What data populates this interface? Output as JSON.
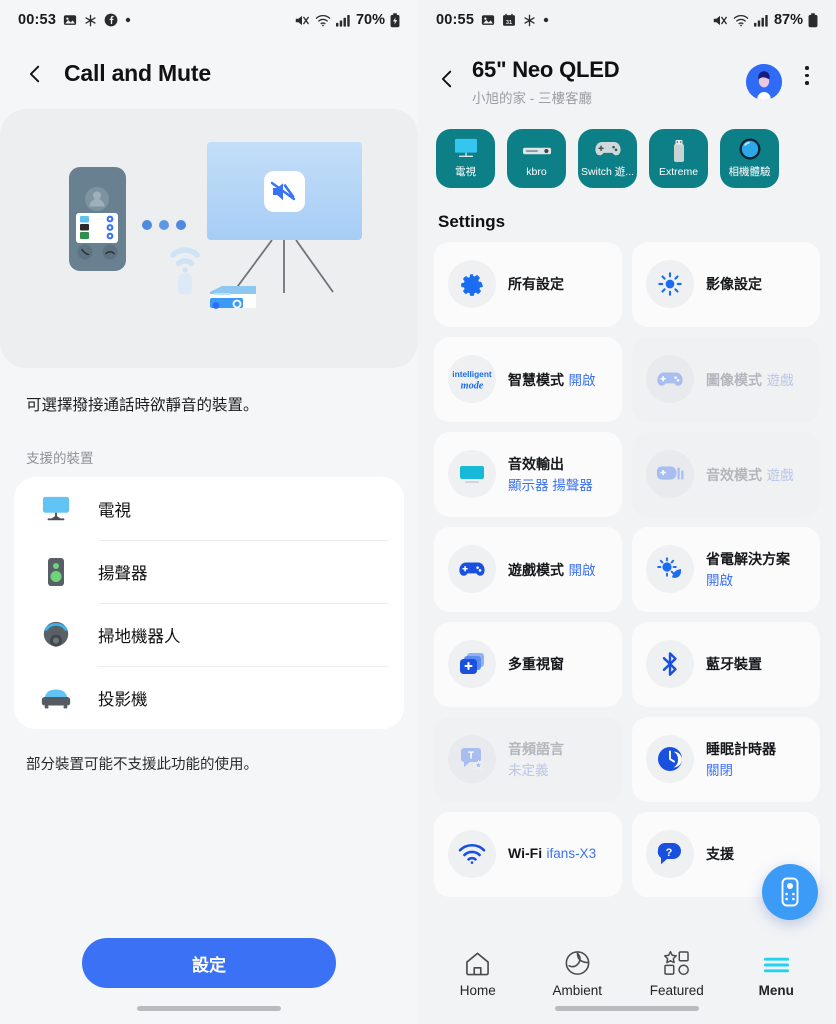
{
  "left": {
    "status": {
      "time": "00:53",
      "battery": "70%",
      "icons": [
        "photo-icon",
        "snowflake-icon",
        "facebook-icon",
        "dot-icon"
      ],
      "right_icons": [
        "mute-icon",
        "wifi-icon",
        "signal-icon",
        "battery-icon"
      ]
    },
    "appbar": {
      "title": "Call and Mute",
      "back": "back-chevron-icon"
    },
    "illustration": {
      "name": "call-mute-illustration",
      "mute_badge": "mute-icon"
    },
    "description": "可選擇撥接通話時欲靜音的裝置。",
    "section_label": "支援的裝置",
    "devices": [
      {
        "label": "電視",
        "icon": "tv-icon"
      },
      {
        "label": "揚聲器",
        "icon": "speaker-icon"
      },
      {
        "label": "掃地機器人",
        "icon": "robot-vacuum-icon"
      },
      {
        "label": "投影機",
        "icon": "projector-icon"
      }
    ],
    "note": "部分裝置可能不支援此功能的使用。",
    "cta": "設定"
  },
  "right": {
    "status": {
      "time": "00:55",
      "battery": "87%",
      "icons": [
        "photo-icon",
        "calendar-icon",
        "snowflake-icon",
        "dot-icon"
      ],
      "right_icons": [
        "mute-icon",
        "wifi-icon",
        "signal-icon",
        "battery-icon"
      ]
    },
    "appbar": {
      "title": "65\" Neo QLED",
      "subtitle": "小旭的家 - 三樓客廳",
      "back": "back-chevron-icon",
      "avatar": "user-avatar",
      "more": "more-options-icon"
    },
    "sources": [
      {
        "label": "電視",
        "icon": "tv-icon"
      },
      {
        "label": "kbro",
        "icon": "set-top-box-icon"
      },
      {
        "label": "Switch 遊...",
        "icon": "gamepad-icon"
      },
      {
        "label": "Extreme",
        "icon": "usb-drive-icon"
      },
      {
        "label": "相機體驗",
        "icon": "camera-lens-icon"
      }
    ],
    "settings_title": "Settings",
    "tiles": [
      {
        "title": "所有設定",
        "value": "",
        "icon": "gear-icon",
        "dim": false
      },
      {
        "title": "影像設定",
        "value": "",
        "icon": "brightness-icon",
        "dim": false
      },
      {
        "title": "智慧模式",
        "value": "開啟",
        "icon": "intelligent-mode-icon",
        "dim": false
      },
      {
        "title": "圖像模式",
        "value": "遊戲",
        "icon": "gamepad-icon",
        "dim": true
      },
      {
        "title": "音效輸出",
        "value": "顯示器 揚聲器",
        "icon": "tv-speaker-icon",
        "dim": false
      },
      {
        "title": "音效模式",
        "value": "遊戲",
        "icon": "sound-mode-icon",
        "dim": true
      },
      {
        "title": "遊戲模式",
        "value": "開啟",
        "icon": "gamepad-icon",
        "dim": false
      },
      {
        "title": "省電解決方案",
        "value": "開啟",
        "icon": "eco-icon",
        "dim": false
      },
      {
        "title": "多重視窗",
        "value": "",
        "icon": "multi-window-icon",
        "dim": false
      },
      {
        "title": "藍牙裝置",
        "value": "",
        "icon": "bluetooth-icon",
        "dim": false
      },
      {
        "title": "音頻語言",
        "value": "未定義",
        "icon": "audio-language-icon",
        "dim": true
      },
      {
        "title": "睡眠計時器",
        "value": "關閉",
        "icon": "sleep-timer-icon",
        "dim": false
      },
      {
        "title": "Wi-Fi",
        "value": "ifans-X3",
        "icon": "wifi-icon",
        "dim": false
      },
      {
        "title": "支援",
        "value": "",
        "icon": "help-icon",
        "dim": false
      }
    ],
    "fab": "remote-control-icon",
    "nav": [
      {
        "label": "Home",
        "icon": "home-icon",
        "active": false
      },
      {
        "label": "Ambient",
        "icon": "ambient-icon",
        "active": false
      },
      {
        "label": "Featured",
        "icon": "featured-icon",
        "active": false
      },
      {
        "label": "Menu",
        "icon": "menu-icon",
        "active": true
      }
    ]
  },
  "colors": {
    "accent_blue": "#3b72f5",
    "source_teal": "#0d7f86",
    "menu_cyan": "#22d3ee",
    "card_bg": "#fbfbfc",
    "page_bg": "#f5f6f8"
  }
}
